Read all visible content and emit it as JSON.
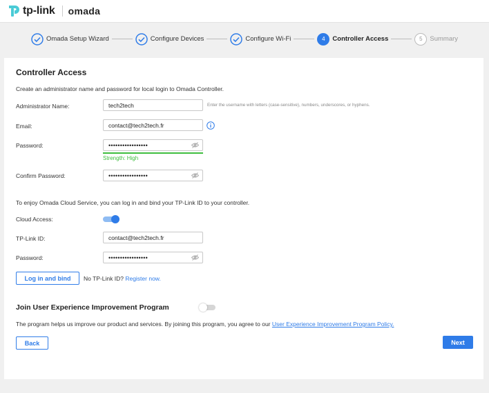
{
  "header": {
    "brand": "tp-link",
    "product": "omada"
  },
  "stepper": {
    "steps": [
      {
        "label": "Omada Setup Wizard",
        "state": "done"
      },
      {
        "label": "Configure Devices",
        "state": "done"
      },
      {
        "label": "Configure Wi-Fi",
        "state": "done"
      },
      {
        "number": "4",
        "label": "Controller Access",
        "state": "active"
      },
      {
        "number": "5",
        "label": "Summary",
        "state": "future"
      }
    ]
  },
  "controller_access": {
    "title": "Controller Access",
    "description": "Create an administrator name and password for local login to Omada Controller.",
    "admin_name_label": "Administrator Name:",
    "admin_name_value": "tech2tech",
    "admin_name_hint": "Enter the username with letters (case-sensitive), numbers, underscores, or hyphens.",
    "email_label": "Email:",
    "email_value": "contact@tech2tech.fr",
    "password_label": "Password:",
    "password_value": "•••••••••••••••••",
    "strength_text": "Strength: High",
    "confirm_label": "Confirm Password:",
    "confirm_value": "•••••••••••••••••"
  },
  "cloud": {
    "description": "To enjoy Omada Cloud Service, you can log in and bind your TP-Link ID to your controller.",
    "access_label": "Cloud Access:",
    "access_enabled": true,
    "id_label": "TP-Link ID:",
    "id_value": "contact@tech2tech.fr",
    "password_label": "Password:",
    "password_value": "•••••••••••••••••",
    "login_button": "Log in and bind",
    "no_id_text": "No TP-Link ID?",
    "register_link": "Register now."
  },
  "uxip": {
    "title": "Join User Experience Improvement Program",
    "enabled": false,
    "description": "The program helps us improve our product and services. By joining this program, you agree to our",
    "policy_link": "User Experience Improvement Program Policy."
  },
  "footer": {
    "back_label": "Back",
    "next_label": "Next"
  },
  "colors": {
    "accent": "#2f7ce8",
    "success": "#3dbd3d",
    "brand_teal": "#4acbd6"
  }
}
